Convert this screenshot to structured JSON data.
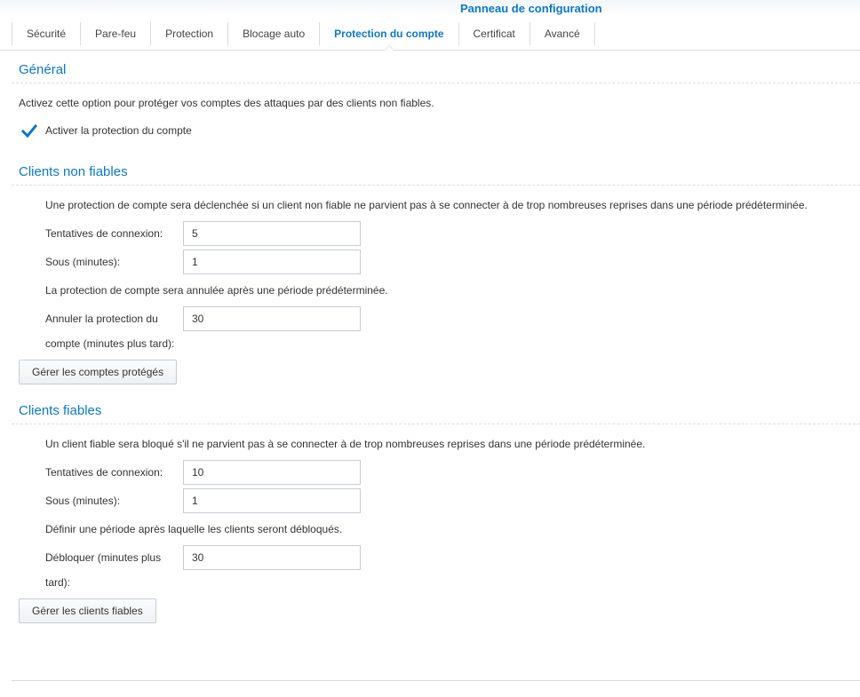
{
  "window": {
    "title": "Panneau de configuration"
  },
  "tabs": [
    {
      "label": "Sécurité"
    },
    {
      "label": "Pare-feu"
    },
    {
      "label": "Protection"
    },
    {
      "label": "Blocage auto"
    },
    {
      "label": "Protection du compte",
      "active": true
    },
    {
      "label": "Certificat"
    },
    {
      "label": "Avancé"
    }
  ],
  "general": {
    "title": "Général",
    "description": "Activez cette option pour protéger vos comptes des attaques par des clients non fiables.",
    "enable_checkbox": {
      "label": "Activer la protection du compte",
      "checked": true
    }
  },
  "untrusted": {
    "title": "Clients non fiables",
    "description": "Une protection de compte sera déclenchée si un client non fiable ne parvient pas à se connecter à de trop nombreuses reprises dans une période prédéterminée.",
    "attempts_label": "Tentatives de connexion:",
    "attempts_value": "5",
    "within_label": "Sous (minutes):",
    "within_value": "1",
    "cancel_note": "La protection de compte sera annulée après une période prédéterminée.",
    "cancel_label_line1": "Annuler la protection du",
    "cancel_label_line2": "compte (minutes plus tard):",
    "cancel_value": "30",
    "manage_button": "Gérer les comptes protégés"
  },
  "trusted": {
    "title": "Clients fiables",
    "description": "Un client fiable sera bloqué s'il ne parvient pas à se connecter à de trop nombreuses reprises dans une période prédéterminée.",
    "attempts_label": "Tentatives de connexion:",
    "attempts_value": "10",
    "within_label": "Sous (minutes):",
    "within_value": "1",
    "unblock_note": "Définir une période après laquelle les clients seront débloqués.",
    "unblock_label_line1": "Débloquer (minutes plus",
    "unblock_label_line2": "tard):",
    "unblock_value": "30",
    "manage_button": "Gérer les clients fiables"
  },
  "colors": {
    "accent": "#0a78c8",
    "border": "#d6dbe2",
    "text": "#333333"
  },
  "icons": {
    "checkbox": "check-icon"
  }
}
